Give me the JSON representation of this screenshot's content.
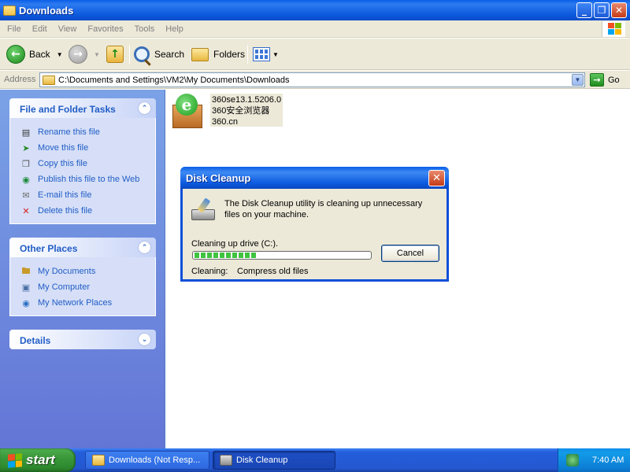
{
  "window": {
    "title": "Downloads",
    "caption_buttons": {
      "minimize": "_",
      "maximize": "❐",
      "close": "✕"
    }
  },
  "menu": [
    "File",
    "Edit",
    "View",
    "Favorites",
    "Tools",
    "Help"
  ],
  "toolbar": {
    "back_label": "Back",
    "search_label": "Search",
    "folders_label": "Folders"
  },
  "address": {
    "label": "Address",
    "value": "C:\\Documents and Settings\\VM2\\My Documents\\Downloads",
    "go_label": "Go"
  },
  "sidebar": {
    "tasks": {
      "title": "File and Folder Tasks",
      "items": [
        {
          "label": "Rename this file",
          "icon": "rename-icon"
        },
        {
          "label": "Move this file",
          "icon": "move-icon"
        },
        {
          "label": "Copy this file",
          "icon": "copy-icon"
        },
        {
          "label": "Publish this file to the Web",
          "icon": "publish-web-icon"
        },
        {
          "label": "E-mail this file",
          "icon": "email-icon"
        },
        {
          "label": "Delete this file",
          "icon": "delete-icon"
        }
      ]
    },
    "other_places": {
      "title": "Other Places",
      "items": [
        {
          "label": "My Documents",
          "icon": "my-documents-icon"
        },
        {
          "label": "My Computer",
          "icon": "my-computer-icon"
        },
        {
          "label": "My Network Places",
          "icon": "network-places-icon"
        }
      ]
    },
    "details": {
      "title": "Details"
    }
  },
  "file": {
    "name": "360se13.1.5206.0",
    "description": "360安全浏览器",
    "company": "360.cn",
    "icon": "360-browser-installer-icon"
  },
  "dialog": {
    "title": "Disk Cleanup",
    "message": "The Disk Cleanup utility is cleaning up unnecessary files on your machine.",
    "progress_label": "Cleaning up drive  (C:).",
    "progress": 0.35,
    "cancel_label": "Cancel",
    "status_label": "Cleaning:",
    "status_value": "Compress old files"
  },
  "taskbar": {
    "start_label": "start",
    "buttons": [
      {
        "label": "Downloads (Not Resp...",
        "icon": "folder-icon"
      },
      {
        "label": "Disk Cleanup",
        "icon": "disk-cleanup-icon"
      }
    ],
    "clock": "7:40 AM"
  }
}
